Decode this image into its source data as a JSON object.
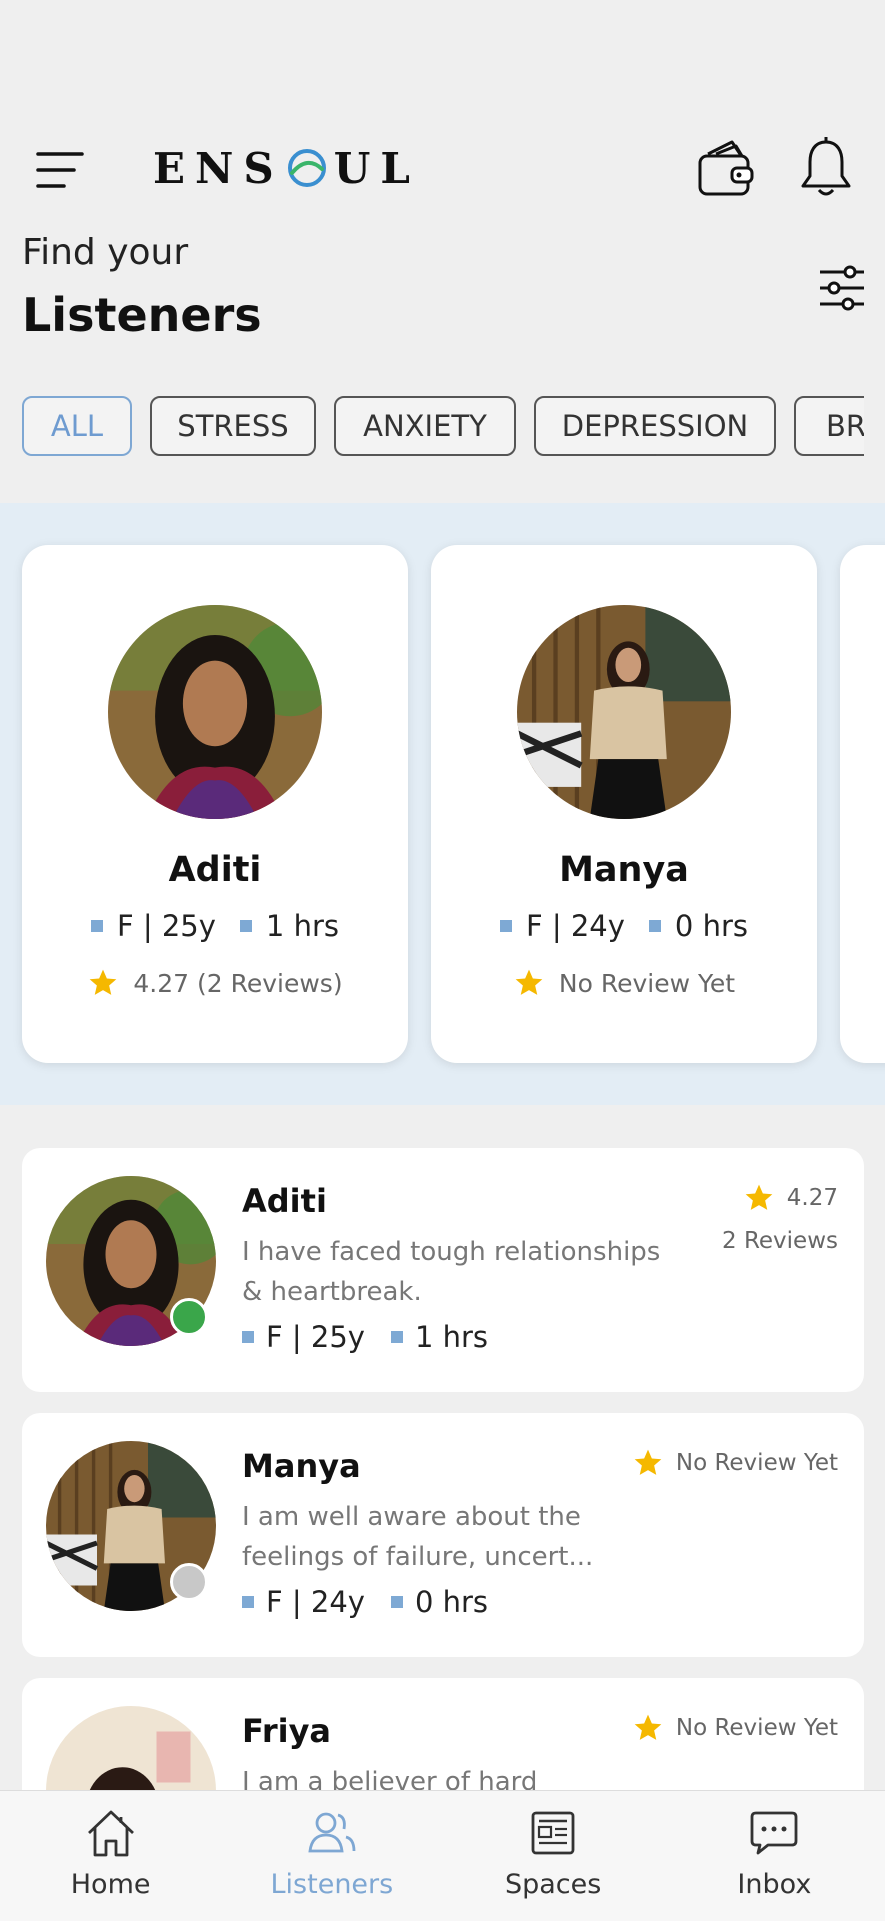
{
  "header": {
    "logo_text": "ENSOUL",
    "find_label": "Find your",
    "title": "Listeners"
  },
  "chips": [
    {
      "label": "ALL",
      "active": true
    },
    {
      "label": "STRESS",
      "active": false
    },
    {
      "label": "ANXIETY",
      "active": false
    },
    {
      "label": "DEPRESSION",
      "active": false
    },
    {
      "label": "BR",
      "active": false
    }
  ],
  "featured": [
    {
      "name": "Aditi",
      "gender_age": "F | 25y",
      "hours": "1 hrs",
      "rating_text": "4.27 (2 Reviews)"
    },
    {
      "name": "Manya",
      "gender_age": "F | 24y",
      "hours": "0 hrs",
      "rating_text": "No Review Yet"
    }
  ],
  "listeners": [
    {
      "name": "Aditi",
      "description": "I have faced tough relationships & heartbreak.",
      "gender_age": "F | 25y",
      "hours": "1 hrs",
      "rating": "4.27",
      "reviews": "2 Reviews",
      "status": "online"
    },
    {
      "name": "Manya",
      "description": "I am well aware about the feelings of failure, uncert...",
      "gender_age": "F | 24y",
      "hours": "0 hrs",
      "rating": "No Review Yet",
      "status": "offline"
    },
    {
      "name": "Friya",
      "description": "I am a believer of hard",
      "rating": "No Review Yet"
    }
  ],
  "nav": [
    {
      "label": "Home",
      "icon": "home-icon"
    },
    {
      "label": "Listeners",
      "icon": "listeners-icon",
      "active": true
    },
    {
      "label": "Spaces",
      "icon": "spaces-icon"
    },
    {
      "label": "Inbox",
      "icon": "inbox-icon"
    }
  ],
  "colors": {
    "accent": "#7ea7d3",
    "star": "#f5b800",
    "online": "#3aa64a",
    "offline": "#c8c8c8",
    "band": "#e3edf5"
  }
}
